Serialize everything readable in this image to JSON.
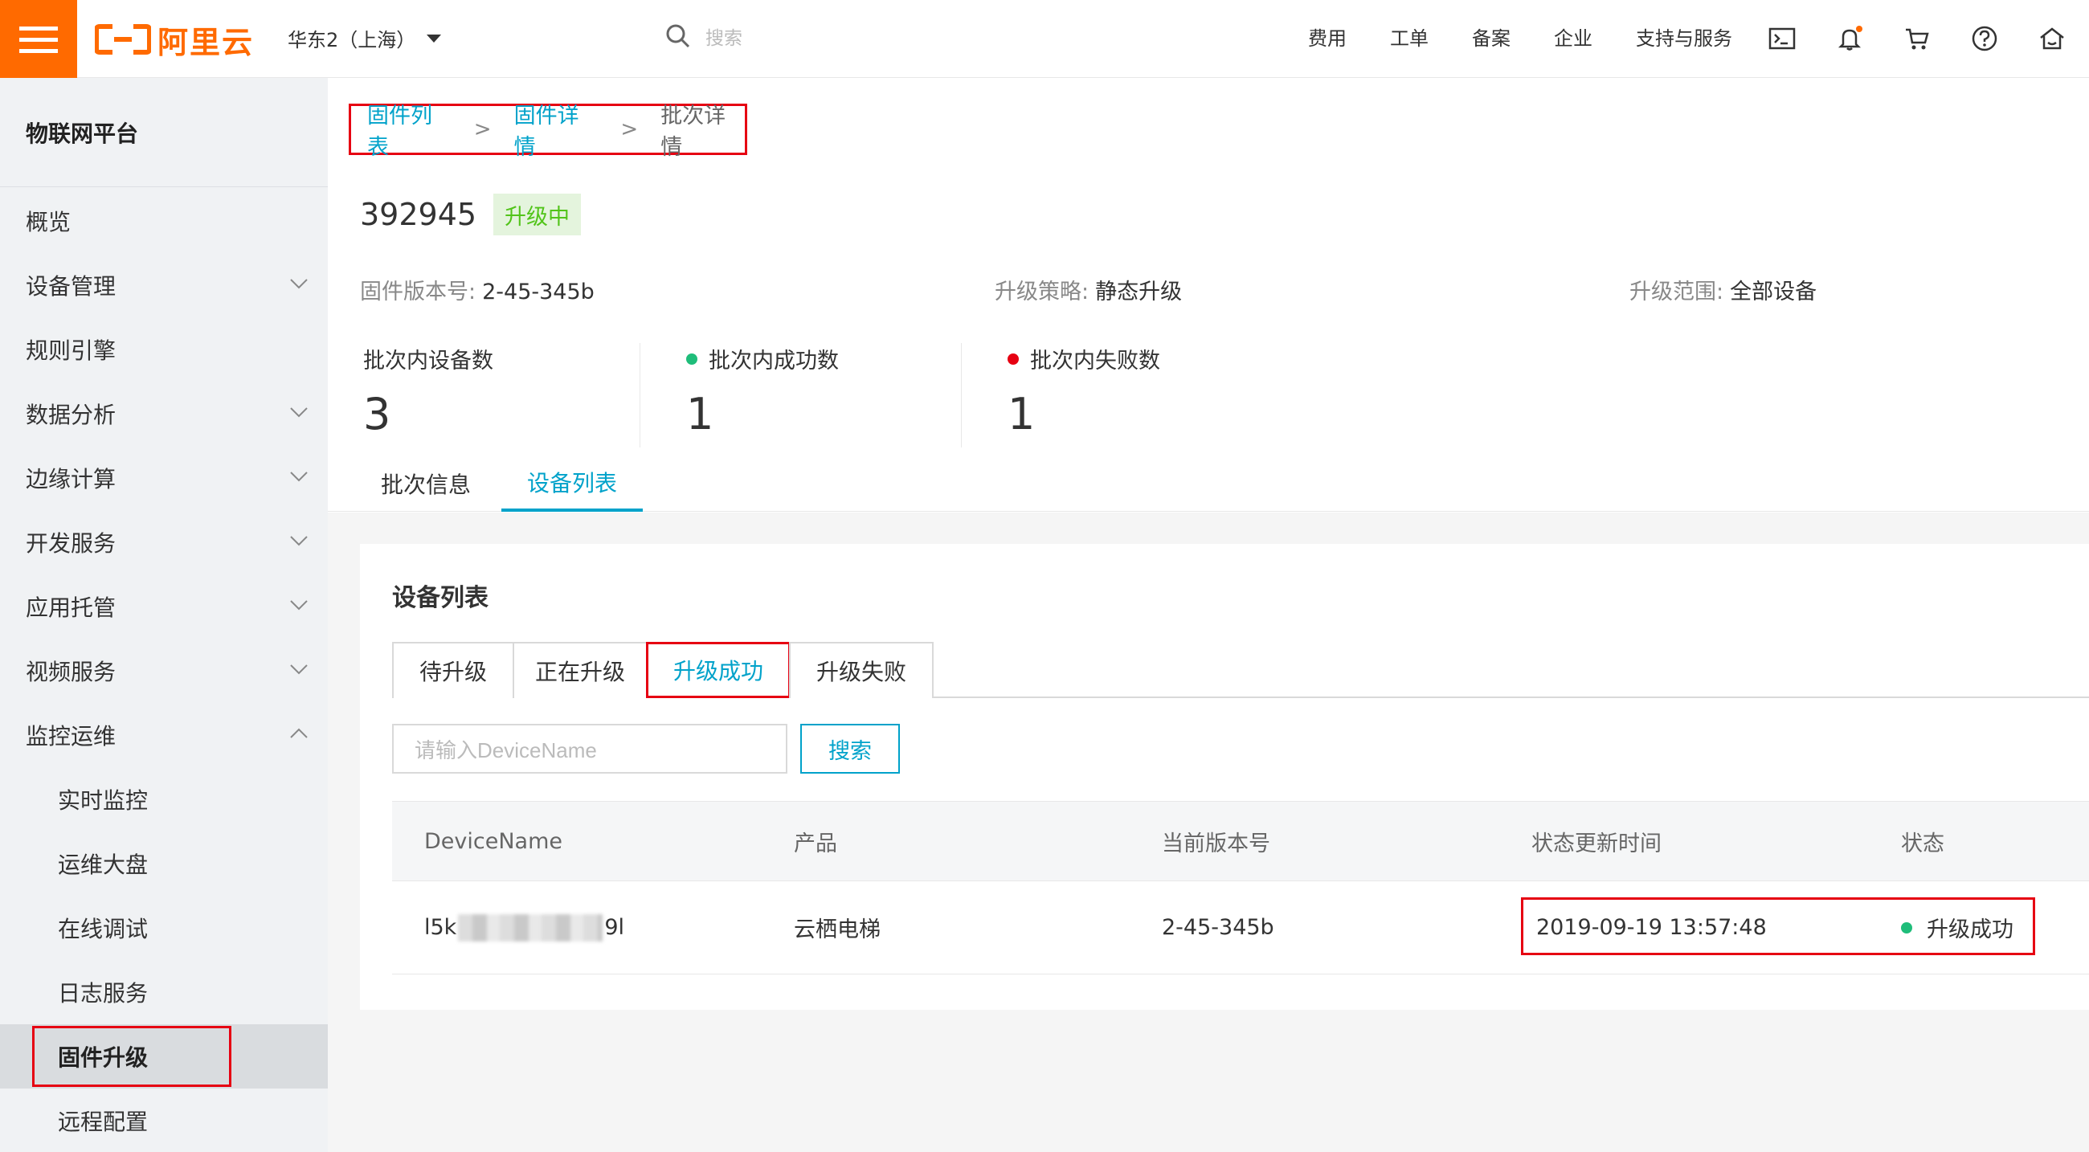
{
  "topbar": {
    "brand": "阿里云",
    "region": "华东2（上海）",
    "search_placeholder": "搜索",
    "nav": [
      "费用",
      "工单",
      "备案",
      "企业",
      "支持与服务"
    ],
    "icons": [
      "terminal-icon",
      "bell-icon",
      "cart-icon",
      "help-icon",
      "home-icon"
    ]
  },
  "sidebar": {
    "platform": "物联网平台",
    "items": [
      {
        "label": "概览"
      },
      {
        "label": "设备管理"
      },
      {
        "label": "规则引擎"
      },
      {
        "label": "数据分析"
      },
      {
        "label": "边缘计算"
      },
      {
        "label": "开发服务"
      },
      {
        "label": "应用托管"
      },
      {
        "label": "视频服务"
      },
      {
        "label": "监控运维"
      },
      {
        "label": "实时监控"
      },
      {
        "label": "运维大盘"
      },
      {
        "label": "在线调试"
      },
      {
        "label": "日志服务"
      },
      {
        "label": "固件升级"
      },
      {
        "label": "远程配置"
      }
    ]
  },
  "breadcrumb": {
    "items": [
      "固件列表",
      "固件详情",
      "批次详情"
    ],
    "sep": ">"
  },
  "batch": {
    "id": "392945",
    "status": "升级中",
    "meta": [
      {
        "key": "固件版本号:",
        "value": "2-45-345b"
      },
      {
        "key": "升级策略:",
        "value": "静态升级"
      },
      {
        "key": "升级范围:",
        "value": "全部设备"
      }
    ],
    "stats": [
      {
        "label": "批次内设备数",
        "value": "3"
      },
      {
        "label": "批次内成功数",
        "value": "1"
      },
      {
        "label": "批次内失败数",
        "value": "1"
      }
    ]
  },
  "tabs": [
    "批次信息",
    "设备列表"
  ],
  "device_list": {
    "title": "设备列表",
    "subtabs": [
      "待升级",
      "正在升级",
      "升级成功",
      "升级失败"
    ],
    "input_placeholder": "请输入DeviceName",
    "search_label": "搜索",
    "columns": [
      "DeviceName",
      "产品",
      "当前版本号",
      "状态更新时间",
      "状态"
    ],
    "rows": [
      {
        "device_prefix": "l5k",
        "device_suffix": "9l",
        "product": "云栖电梯",
        "version": "2-45-345b",
        "time": "2019-09-19 13:57:48",
        "status": "升级成功"
      }
    ]
  },
  "colors": {
    "brand": "#ff6a00",
    "link": "#00a2ca",
    "success": "#1fbd7a",
    "fail": "#e60012",
    "highlight": "#e60012"
  }
}
